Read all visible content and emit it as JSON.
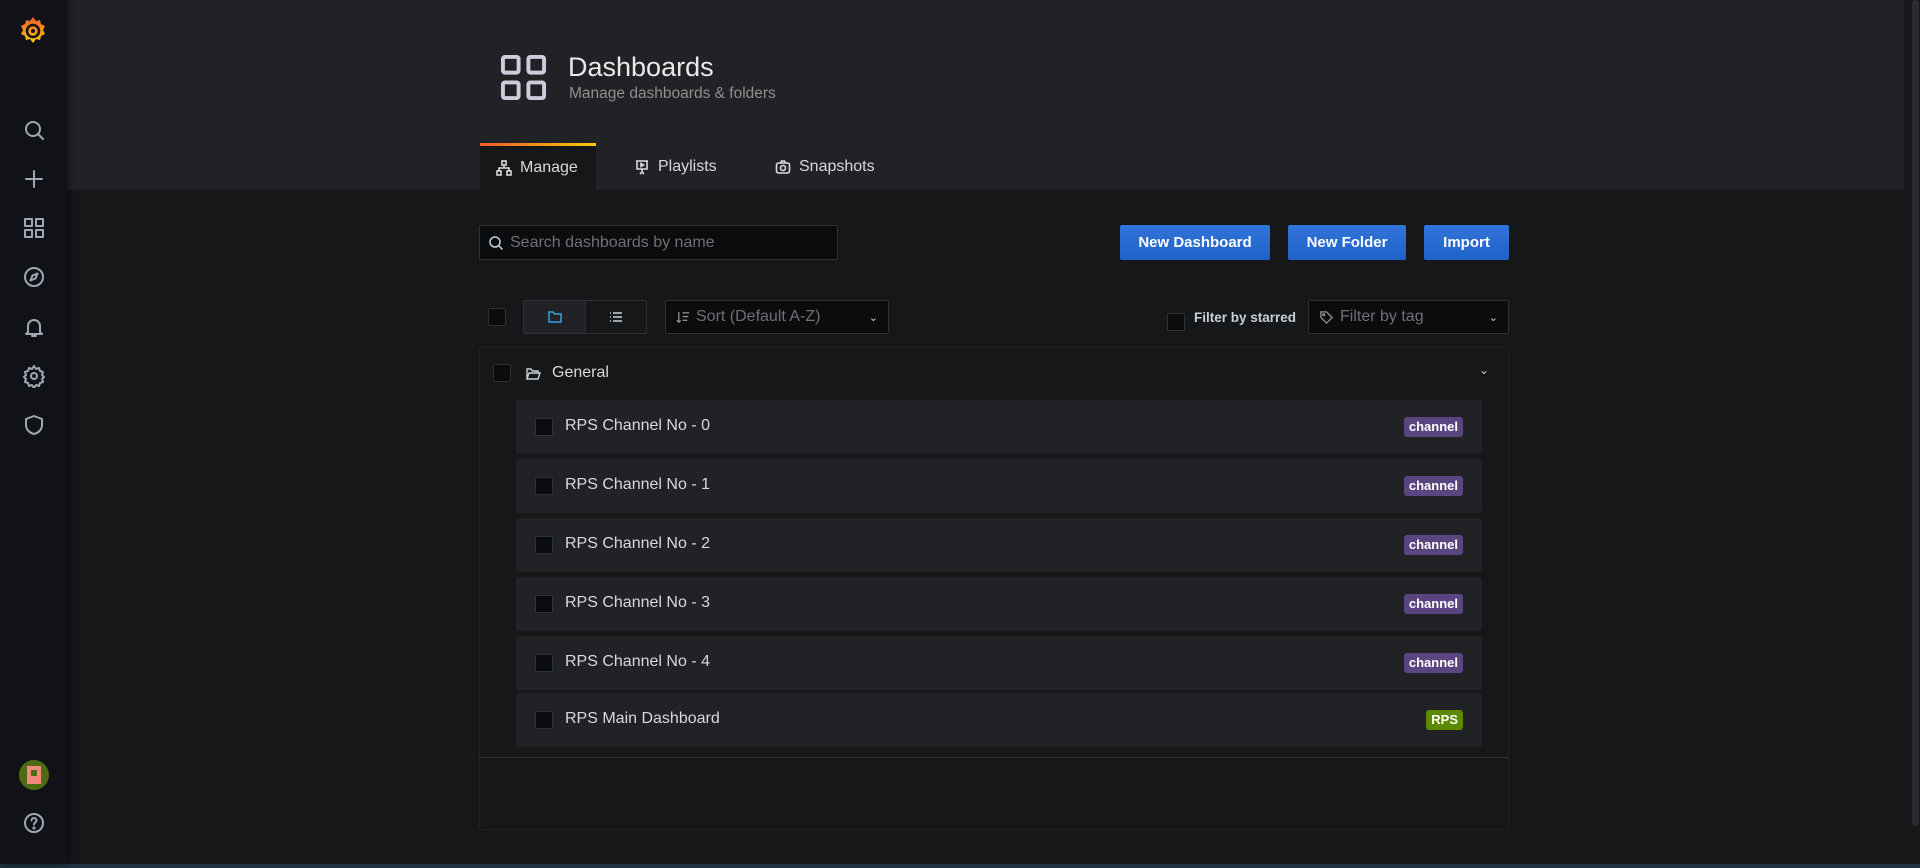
{
  "page": {
    "title": "Dashboards",
    "subtitle": "Manage dashboards & folders"
  },
  "tabs": [
    {
      "label": "Manage",
      "icon": "sitemap-icon"
    },
    {
      "label": "Playlists",
      "icon": "presentation-play-icon"
    },
    {
      "label": "Snapshots",
      "icon": "camera-icon"
    }
  ],
  "toolbar": {
    "search_placeholder": "Search dashboards by name",
    "new_dashboard": "New Dashboard",
    "new_folder": "New Folder",
    "import": "Import"
  },
  "filters": {
    "sort_placeholder": "Sort (Default A-Z)",
    "starred_label": "Filter by starred",
    "tag_placeholder": "Filter by tag"
  },
  "folder": {
    "name": "General"
  },
  "dashboards": [
    {
      "name": "RPS Channel No - 0",
      "tag": "channel",
      "tag_color": "#5a4581"
    },
    {
      "name": "RPS Channel No - 1",
      "tag": "channel",
      "tag_color": "#5a4581"
    },
    {
      "name": "RPS Channel No - 2",
      "tag": "channel",
      "tag_color": "#5a4581"
    },
    {
      "name": "RPS Channel No - 3",
      "tag": "channel",
      "tag_color": "#5a4581"
    },
    {
      "name": "RPS Channel No - 4",
      "tag": "channel",
      "tag_color": "#5a4581"
    },
    {
      "name": "RPS Main Dashboard",
      "tag": "RPS",
      "tag_color": "#5b8a00"
    }
  ],
  "colors": {
    "primary": "#3274d9",
    "background": "#161719",
    "header": "#202226"
  }
}
